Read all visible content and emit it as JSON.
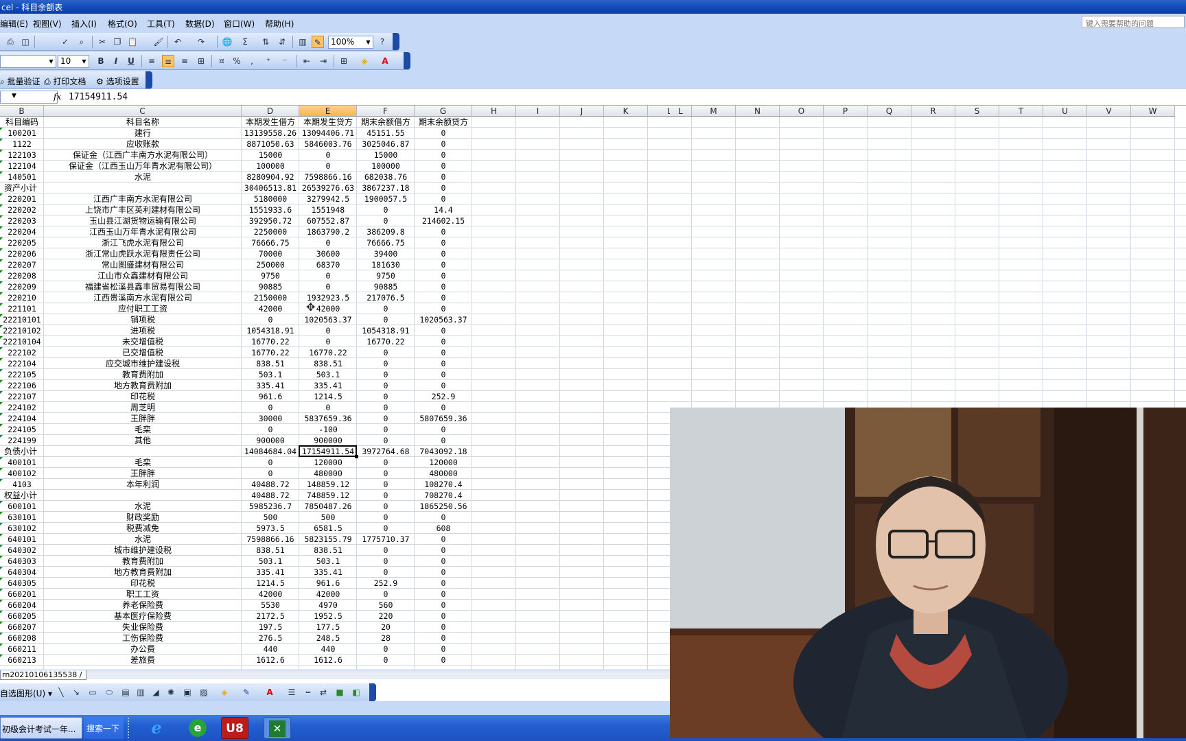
{
  "window": {
    "title": "cel - 科目余额表",
    "help_placeholder": "键入需要帮助的问题"
  },
  "menu": [
    "编辑(E)",
    "视图(V)",
    "插入(I)",
    "格式(O)",
    "工具(T)",
    "数据(D)",
    "窗口(W)",
    "帮助(H)"
  ],
  "toolbar": {
    "zoom": "100%",
    "font_size": "10",
    "bold": "B",
    "italic": "I",
    "underline": "U",
    "percent": "%",
    "comma": ","
  },
  "addin_toolbar": {
    "batch_verify": "批量验证",
    "print_doc": "打印文档",
    "options": "选项设置"
  },
  "formula_bar": {
    "fx": "fx",
    "value": "17154911.54"
  },
  "columns": [
    "B",
    "C",
    "D",
    "E",
    "F",
    "G",
    "H",
    "I",
    "J",
    "K",
    "L",
    "M",
    "N",
    "O",
    "P",
    "Q",
    "R",
    "S",
    "T",
    "U",
    "V",
    "W"
  ],
  "selected_column": "E",
  "headers": [
    "科目编码",
    "科目名称",
    "本期发生借方",
    "本期发生贷方",
    "期末余额借方",
    "期末余额贷方"
  ],
  "rows": [
    [
      "100201",
      "建行",
      "13139558.26",
      "13094406.71",
      "45151.55",
      "0"
    ],
    [
      "1122",
      "应收账款",
      "8871050.63",
      "5846003.76",
      "3025046.87",
      "0"
    ],
    [
      "122103",
      "保证金（江西广丰南方水泥有限公司）",
      "15000",
      "0",
      "15000",
      "0"
    ],
    [
      "122104",
      "保证金（江西玉山万年青水泥有限公司）",
      "100000",
      "0",
      "100000",
      "0"
    ],
    [
      "140501",
      "水泥",
      "8280904.92",
      "7598866.16",
      "682038.76",
      "0"
    ],
    [
      "资产小计",
      "",
      "30406513.81",
      "26539276.63",
      "3867237.18",
      "0"
    ],
    [
      "220201",
      "江西广丰南方水泥有限公司",
      "5180000",
      "3279942.5",
      "1900057.5",
      "0"
    ],
    [
      "220202",
      "上饶市广丰区英利建材有限公司",
      "1551933.6",
      "1551948",
      "0",
      "14.4"
    ],
    [
      "220203",
      "玉山县江湖货物运输有限公司",
      "392950.72",
      "607552.87",
      "0",
      "214602.15"
    ],
    [
      "220204",
      "江西玉山万年青水泥有限公司",
      "2250000",
      "1863790.2",
      "386209.8",
      "0"
    ],
    [
      "220205",
      "浙江飞虎水泥有限公司",
      "76666.75",
      "0",
      "76666.75",
      "0"
    ],
    [
      "220206",
      "浙江常山虎跃水泥有限责任公司",
      "70000",
      "30600",
      "39400",
      "0"
    ],
    [
      "220207",
      "常山图盛建材有限公司",
      "250000",
      "68370",
      "181630",
      "0"
    ],
    [
      "220208",
      "江山市众鑫建材有限公司",
      "9750",
      "0",
      "9750",
      "0"
    ],
    [
      "220209",
      "福建省松溪县鑫丰贸易有限公司",
      "90885",
      "0",
      "90885",
      "0"
    ],
    [
      "220210",
      "江西贵溪南方水泥有限公司",
      "2150000",
      "1932923.5",
      "217076.5",
      "0"
    ],
    [
      "221101",
      "应付职工工资",
      "42000",
      "42000",
      "0",
      "0"
    ],
    [
      "22210101",
      "销项税",
      "0",
      "1020563.37",
      "0",
      "1020563.37"
    ],
    [
      "22210102",
      "进项税",
      "1054318.91",
      "0",
      "1054318.91",
      "0"
    ],
    [
      "22210104",
      "未交增值税",
      "16770.22",
      "0",
      "16770.22",
      "0"
    ],
    [
      "222102",
      "已交增值税",
      "16770.22",
      "16770.22",
      "0",
      "0"
    ],
    [
      "222104",
      "应交城市维护建设税",
      "838.51",
      "838.51",
      "0",
      "0"
    ],
    [
      "222105",
      "教育费附加",
      "503.1",
      "503.1",
      "0",
      "0"
    ],
    [
      "222106",
      "地方教育费附加",
      "335.41",
      "335.41",
      "0",
      "0"
    ],
    [
      "222107",
      "印花税",
      "961.6",
      "1214.5",
      "0",
      "252.9"
    ],
    [
      "224102",
      "周芝明",
      "0",
      "0",
      "0",
      "0"
    ],
    [
      "224104",
      "王胖胖",
      "30000",
      "5837659.36",
      "0",
      "5807659.36"
    ],
    [
      "224105",
      "毛栾",
      "0",
      "-100",
      "0",
      "0"
    ],
    [
      "224199",
      "其他",
      "900000",
      "900000",
      "0",
      "0"
    ],
    [
      "负债小计",
      "",
      "14084684.04",
      "17154911.54",
      "3972764.68",
      "7043092.18"
    ],
    [
      "400101",
      "毛栾",
      "0",
      "120000",
      "0",
      "120000"
    ],
    [
      "400102",
      "王胖胖",
      "0",
      "480000",
      "0",
      "480000"
    ],
    [
      "4103",
      "本年利润",
      "40488.72",
      "148859.12",
      "0",
      "108270.4"
    ],
    [
      "权益小计",
      "",
      "40488.72",
      "748859.12",
      "0",
      "708270.4"
    ],
    [
      "600101",
      "水泥",
      "5985236.7",
      "7850487.26",
      "0",
      "1865250.56"
    ],
    [
      "630101",
      "财政奖励",
      "500",
      "500",
      "0",
      "0"
    ],
    [
      "630102",
      "税费减免",
      "5973.5",
      "6581.5",
      "0",
      "608"
    ],
    [
      "640101",
      "水泥",
      "7598866.16",
      "5823155.79",
      "1775710.37",
      "0"
    ],
    [
      "640302",
      "城市维护建设税",
      "838.51",
      "838.51",
      "0",
      "0"
    ],
    [
      "640303",
      "教育费附加",
      "503.1",
      "503.1",
      "0",
      "0"
    ],
    [
      "640304",
      "地方教育费附加",
      "335.41",
      "335.41",
      "0",
      "0"
    ],
    [
      "640305",
      "印花税",
      "1214.5",
      "961.6",
      "252.9",
      "0"
    ],
    [
      "660201",
      "职工工资",
      "42000",
      "42000",
      "0",
      "0"
    ],
    [
      "660204",
      "养老保险费",
      "5530",
      "4970",
      "560",
      "0"
    ],
    [
      "660205",
      "基本医疗保险费",
      "2172.5",
      "1952.5",
      "220",
      "0"
    ],
    [
      "660207",
      "失业保险费",
      "197.5",
      "177.5",
      "20",
      "0"
    ],
    [
      "660208",
      "工伤保险费",
      "276.5",
      "248.5",
      "28",
      "0"
    ],
    [
      "660211",
      "办公费",
      "440",
      "440",
      "0",
      "0"
    ],
    [
      "660213",
      "差旅费",
      "1612.6",
      "1612.6",
      "0",
      "0"
    ]
  ],
  "active_cell": {
    "ref": "E",
    "row_label": "负债小计"
  },
  "sheet_tab": "rn20210106135538",
  "draw_toolbar": {
    "autoshapes": "自选图形(U)"
  },
  "taskbar": {
    "app": "初级会计考试一年...",
    "search": "搜索一下",
    "u8": "U8"
  },
  "colors": {
    "accent": "#0f48b7",
    "chrome": "#c6d9f7",
    "selected_header": "#f7b54d",
    "gridline": "#d0d7e5"
  }
}
